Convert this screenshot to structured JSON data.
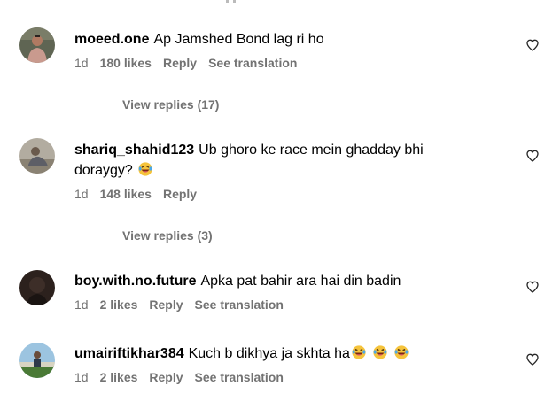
{
  "comments": [
    {
      "username": "moeed.one",
      "text": "Ap Jamshed Bond lag ri ho",
      "text_cont": "",
      "emoji_count": 0,
      "time": "1d",
      "likes": "180 likes",
      "reply_label": "Reply",
      "translate_label": "See translation",
      "avatar_colors": [
        "#6b6e5a",
        "#c89a8c"
      ]
    },
    {
      "username": "shariq_shahid123",
      "text": "Ub ghoro ke race mein ghadday bhi",
      "text_cont": "doraygy?",
      "emoji_count": 1,
      "time": "1d",
      "likes": "148 likes",
      "reply_label": "Reply",
      "translate_label": "",
      "avatar_colors": [
        "#a9a396",
        "#8a8375"
      ]
    },
    {
      "username": "boy.with.no.future",
      "text": "Apka pat bahir ara hai din badin",
      "text_cont": "",
      "emoji_count": 0,
      "time": "1d",
      "likes": "2 likes",
      "reply_label": "Reply",
      "translate_label": "See translation",
      "avatar_colors": [
        "#2a1f1b",
        "#4a3a33"
      ]
    },
    {
      "username": "umairiftikhar384",
      "text": "Kuch b dikhya ja skhta ha",
      "text_cont": "",
      "emoji_count": 3,
      "time": "1d",
      "likes": "2 likes",
      "reply_label": "Reply",
      "translate_label": "See translation",
      "avatar_colors": [
        "#8fb8d6",
        "#3e6b2e"
      ]
    }
  ],
  "view_replies": [
    "View replies (17)",
    "View replies (3)"
  ],
  "colors": {
    "text": "#000000",
    "muted": "#737373",
    "heart_stroke": "#262626",
    "emoji_face": "#f5c33b"
  },
  "icons": {
    "heart": "heart-outline-icon",
    "emoji": "laughing-tears-emoji-icon"
  }
}
